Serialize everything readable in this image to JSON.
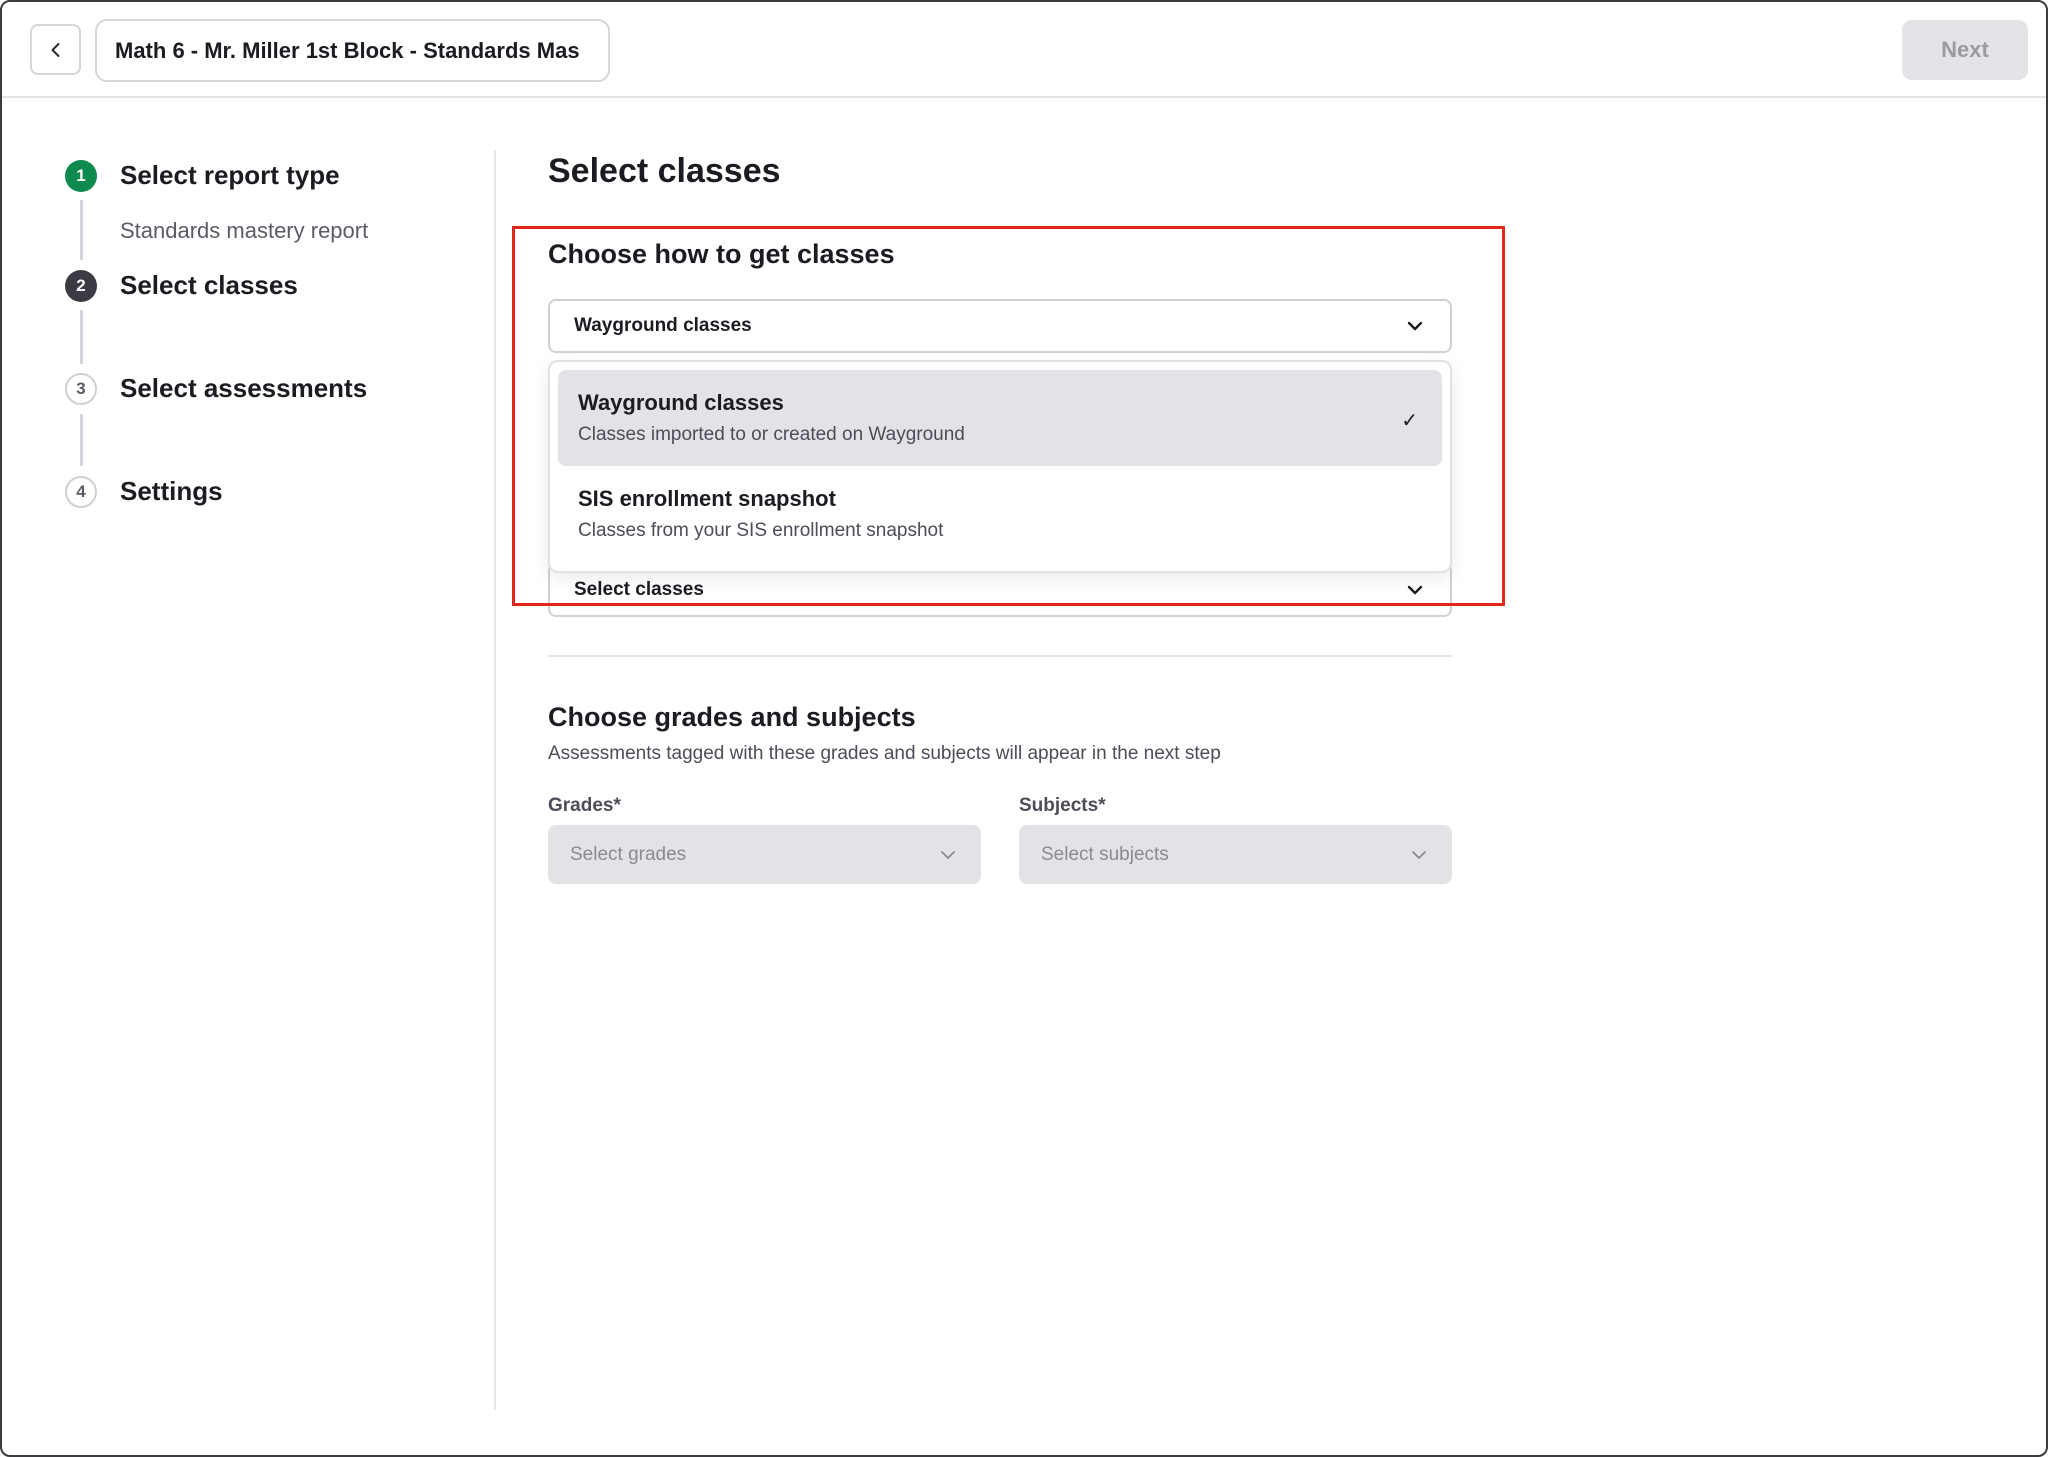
{
  "header": {
    "title": "Math 6 - Mr. Miller 1st Block - Standards Mas",
    "next_label": "Next"
  },
  "stepper": {
    "steps": [
      {
        "number": "1",
        "label": "Select report type",
        "sub": "Standards mastery report",
        "state": "done"
      },
      {
        "number": "2",
        "label": "Select classes",
        "state": "active"
      },
      {
        "number": "3",
        "label": "Select assessments",
        "state": "todo"
      },
      {
        "number": "4",
        "label": "Settings",
        "state": "todo"
      }
    ]
  },
  "main": {
    "title": "Select classes",
    "source_section": {
      "title": "Choose how to get classes",
      "selected_value": "Wayground classes",
      "options": [
        {
          "title": "Wayground classes",
          "description": "Classes imported to or created on Wayground",
          "selected": true
        },
        {
          "title": "SIS enrollment snapshot",
          "description": "Classes from your SIS enrollment snapshot",
          "selected": false
        }
      ],
      "classes_select_label": "Select classes"
    },
    "grades_section": {
      "title": "Choose grades and subjects",
      "description": "Assessments tagged with these grades and subjects will appear in the next step",
      "grades_label": "Grades*",
      "grades_placeholder": "Select grades",
      "subjects_label": "Subjects*",
      "subjects_placeholder": "Select subjects"
    }
  },
  "icons": {
    "back": "chevron-left-icon",
    "dropdown": "chevron-down-icon",
    "check": "checkmark-icon"
  },
  "colors": {
    "step_done": "#0f8a4f",
    "step_active": "#3b3b44",
    "highlight": "#e3261b",
    "next_disabled_bg": "#e4e4e8"
  }
}
